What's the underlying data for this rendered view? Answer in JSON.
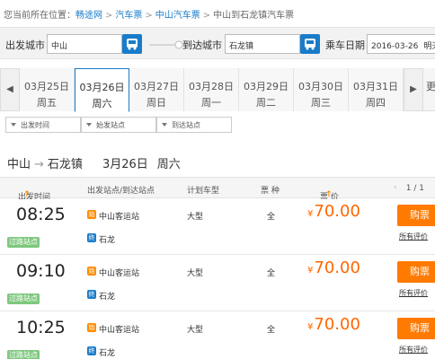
{
  "breadcrumb": {
    "prefix": "您当前所在位置：",
    "items": [
      "畅途网",
      "汽车票",
      "中山汽车票"
    ],
    "current": "中山到石龙镇汽车票"
  },
  "search": {
    "from_label": "出发城市",
    "from_value": "中山",
    "to_label": "到达城市",
    "to_value": "石龙镇",
    "date_label": "乘车日期",
    "date_value": "2016-03-26",
    "date_hint": "明天"
  },
  "date_strip": {
    "active_index": 1,
    "dates": [
      {
        "date": "03月25日",
        "weekday": "周五"
      },
      {
        "date": "03月26日",
        "weekday": "周六"
      },
      {
        "date": "03月27日",
        "weekday": "周日"
      },
      {
        "date": "03月28日",
        "weekday": "周一"
      },
      {
        "date": "03月29日",
        "weekday": "周二"
      },
      {
        "date": "03月30日",
        "weekday": "周三"
      },
      {
        "date": "03月31日",
        "weekday": "周四"
      }
    ],
    "partial": "更"
  },
  "filters": [
    "出发时间",
    "始发站点",
    "到达站点"
  ],
  "route": {
    "from": "中山",
    "arrow": "→",
    "to": "石龙镇",
    "date": "3月26日",
    "weekday": "周六"
  },
  "table": {
    "headers": {
      "time": "出发时间",
      "stations": "出发站点/到达站点",
      "model": "计划车型",
      "type": "票 种",
      "price": "票 价",
      "pager": "1 / 1"
    },
    "rows": [
      {
        "time": "08:25",
        "tag": "过路站点",
        "dep_icon": "始",
        "dep": "中山客运站",
        "arr_icon": "终",
        "arr": "石龙",
        "model": "大型",
        "type": "全",
        "currency": "¥",
        "price": "70.00",
        "buy": "购票",
        "reviews": "所有评价"
      },
      {
        "time": "09:10",
        "tag": "过路站点",
        "dep_icon": "始",
        "dep": "中山客运站",
        "arr_icon": "终",
        "arr": "石龙",
        "model": "大型",
        "type": "全",
        "currency": "¥",
        "price": "70.00",
        "buy": "购票",
        "reviews": "所有评价"
      },
      {
        "time": "10:25",
        "tag": "过路站点",
        "dep_icon": "始",
        "dep": "中山客运站",
        "arr_icon": "终",
        "arr": "石龙",
        "model": "大型",
        "type": "全",
        "currency": "¥",
        "price": "70.00",
        "buy": "购票",
        "reviews": "所有评价"
      }
    ]
  },
  "colors": {
    "brand_blue": "#1a7cc9",
    "accent_orange": "#ff7a00",
    "price_orange": "#ff6600",
    "tag_green": "#7ec87e"
  }
}
